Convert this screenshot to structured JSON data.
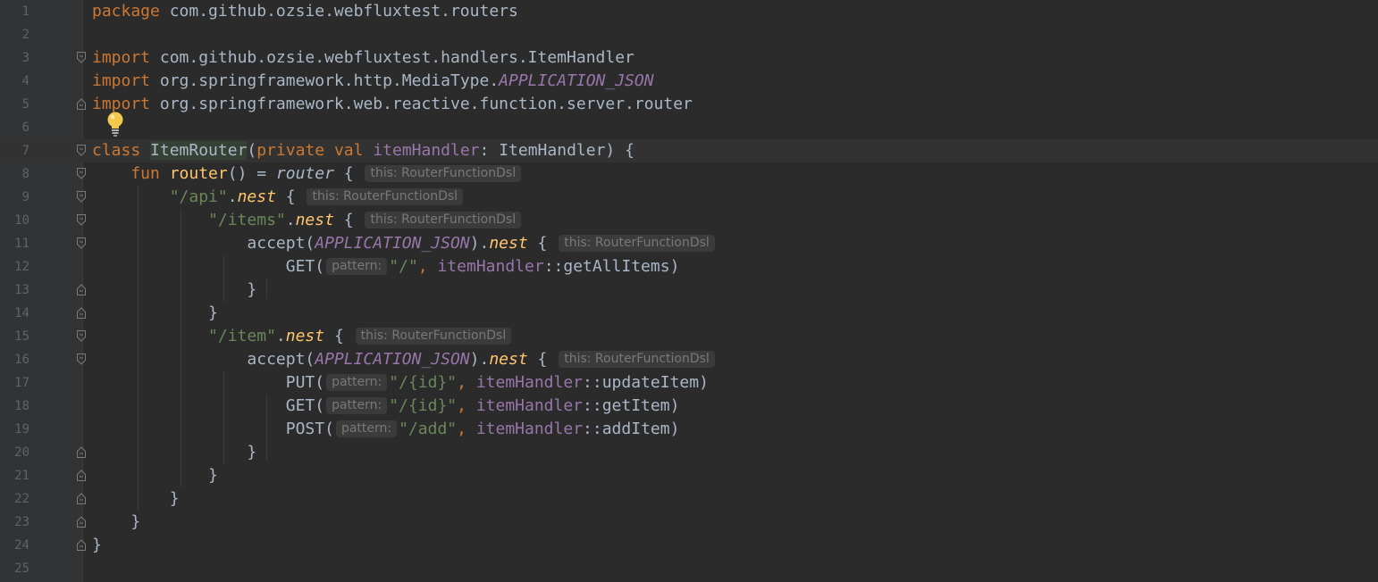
{
  "editor": {
    "language": "kotlin",
    "current_line": 7,
    "lines": [
      {
        "n": "1",
        "fold": "",
        "tokens": [
          {
            "t": "package",
            "c": "kw"
          },
          {
            "t": " com.github.ozsie.webfluxtest.routers",
            "c": ""
          }
        ]
      },
      {
        "n": "2",
        "fold": "",
        "tokens": []
      },
      {
        "n": "3",
        "fold": "open",
        "tokens": [
          {
            "t": "import",
            "c": "kw"
          },
          {
            "t": " com.github.ozsie.webfluxtest.handlers.ItemHandler",
            "c": ""
          }
        ]
      },
      {
        "n": "4",
        "fold": "",
        "tokens": [
          {
            "t": "import",
            "c": "kw"
          },
          {
            "t": " org.springframework.http.MediaType.",
            "c": ""
          },
          {
            "t": "APPLICATION_JSON",
            "c": "const"
          }
        ]
      },
      {
        "n": "5",
        "fold": "close",
        "tokens": [
          {
            "t": "import",
            "c": "kw"
          },
          {
            "t": " org.springframework.web.reactive.function.server.router",
            "c": ""
          }
        ]
      },
      {
        "n": "6",
        "fold": "",
        "tokens": []
      },
      {
        "n": "7",
        "fold": "open",
        "tokens": [
          {
            "t": "class",
            "c": "kw"
          },
          {
            "t": " ",
            "c": ""
          },
          {
            "t": "ItemRouter",
            "c": "cls-hl"
          },
          {
            "t": "(",
            "c": ""
          },
          {
            "t": "private val",
            "c": "kw"
          },
          {
            "t": " ",
            "c": ""
          },
          {
            "t": "itemHandler",
            "c": "prop"
          },
          {
            "t": ": ItemHandler) {",
            "c": ""
          }
        ]
      },
      {
        "n": "8",
        "fold": "open",
        "tokens": [
          {
            "t": "    fun",
            "c": "kw"
          },
          {
            "t": " ",
            "c": ""
          },
          {
            "t": "router",
            "c": "fn"
          },
          {
            "t": "() = ",
            "c": ""
          },
          {
            "t": "router",
            "c": "ital"
          },
          {
            "t": " { ",
            "c": ""
          },
          {
            "t": "this: RouterFunctionDsl",
            "c": "hint"
          }
        ]
      },
      {
        "n": "9",
        "fold": "open",
        "tokens": [
          {
            "t": "        ",
            "c": ""
          },
          {
            "t": "\"/api\"",
            "c": "str"
          },
          {
            "t": ".",
            "c": ""
          },
          {
            "t": "nest",
            "c": "ext"
          },
          {
            "t": " { ",
            "c": ""
          },
          {
            "t": "this: RouterFunctionDsl",
            "c": "hint"
          }
        ]
      },
      {
        "n": "10",
        "fold": "open",
        "tokens": [
          {
            "t": "            ",
            "c": ""
          },
          {
            "t": "\"/items\"",
            "c": "str"
          },
          {
            "t": ".",
            "c": ""
          },
          {
            "t": "nest",
            "c": "ext"
          },
          {
            "t": " { ",
            "c": ""
          },
          {
            "t": "this: RouterFunctionDsl",
            "c": "hint"
          }
        ]
      },
      {
        "n": "11",
        "fold": "open",
        "tokens": [
          {
            "t": "                accept(",
            "c": ""
          },
          {
            "t": "APPLICATION_JSON",
            "c": "const"
          },
          {
            "t": ").",
            "c": ""
          },
          {
            "t": "nest",
            "c": "ext"
          },
          {
            "t": " { ",
            "c": ""
          },
          {
            "t": "this: RouterFunctionDsl",
            "c": "hint"
          }
        ]
      },
      {
        "n": "12",
        "fold": "",
        "tokens": [
          {
            "t": "                    GET(",
            "c": ""
          },
          {
            "t": "pattern:",
            "c": "hint"
          },
          {
            "t": "\"/\"",
            "c": "str"
          },
          {
            "t": ", ",
            "c": "kw"
          },
          {
            "t": "itemHandler",
            "c": "prop"
          },
          {
            "t": "::getAllItems)",
            "c": ""
          }
        ]
      },
      {
        "n": "13",
        "fold": "close",
        "tokens": [
          {
            "t": "                }",
            "c": ""
          }
        ]
      },
      {
        "n": "14",
        "fold": "close",
        "tokens": [
          {
            "t": "            }",
            "c": ""
          }
        ]
      },
      {
        "n": "15",
        "fold": "open",
        "tokens": [
          {
            "t": "            ",
            "c": ""
          },
          {
            "t": "\"/item\"",
            "c": "str"
          },
          {
            "t": ".",
            "c": ""
          },
          {
            "t": "nest",
            "c": "ext"
          },
          {
            "t": " { ",
            "c": ""
          },
          {
            "t": "this: RouterFunctionDsl",
            "c": "hint"
          }
        ]
      },
      {
        "n": "16",
        "fold": "open",
        "tokens": [
          {
            "t": "                accept(",
            "c": ""
          },
          {
            "t": "APPLICATION_JSON",
            "c": "const"
          },
          {
            "t": ").",
            "c": ""
          },
          {
            "t": "nest",
            "c": "ext"
          },
          {
            "t": " { ",
            "c": ""
          },
          {
            "t": "this: RouterFunctionDsl",
            "c": "hint"
          }
        ]
      },
      {
        "n": "17",
        "fold": "",
        "tokens": [
          {
            "t": "                    PUT(",
            "c": ""
          },
          {
            "t": "pattern:",
            "c": "hint"
          },
          {
            "t": "\"/{id}\"",
            "c": "str"
          },
          {
            "t": ", ",
            "c": "kw"
          },
          {
            "t": "itemHandler",
            "c": "prop"
          },
          {
            "t": "::updateItem)",
            "c": ""
          }
        ]
      },
      {
        "n": "18",
        "fold": "",
        "tokens": [
          {
            "t": "                    GET(",
            "c": ""
          },
          {
            "t": "pattern:",
            "c": "hint"
          },
          {
            "t": "\"/{id}\"",
            "c": "str"
          },
          {
            "t": ", ",
            "c": "kw"
          },
          {
            "t": "itemHandler",
            "c": "prop"
          },
          {
            "t": "::getItem)",
            "c": ""
          }
        ]
      },
      {
        "n": "19",
        "fold": "",
        "tokens": [
          {
            "t": "                    POST(",
            "c": ""
          },
          {
            "t": "pattern:",
            "c": "hint"
          },
          {
            "t": "\"/add\"",
            "c": "str"
          },
          {
            "t": ", ",
            "c": "kw"
          },
          {
            "t": "itemHandler",
            "c": "prop"
          },
          {
            "t": "::addItem)",
            "c": ""
          }
        ]
      },
      {
        "n": "20",
        "fold": "close",
        "tokens": [
          {
            "t": "                }",
            "c": ""
          }
        ]
      },
      {
        "n": "21",
        "fold": "close",
        "tokens": [
          {
            "t": "            }",
            "c": ""
          }
        ]
      },
      {
        "n": "22",
        "fold": "close",
        "tokens": [
          {
            "t": "        }",
            "c": ""
          }
        ]
      },
      {
        "n": "23",
        "fold": "close",
        "tokens": [
          {
            "t": "    }",
            "c": ""
          }
        ]
      },
      {
        "n": "24",
        "fold": "close",
        "tokens": [
          {
            "t": "}",
            "c": ""
          }
        ]
      },
      {
        "n": "25",
        "fold": "",
        "tokens": []
      }
    ]
  },
  "icons": {
    "intention_bulb": "lightbulb-icon",
    "fold_open": "fold-open-icon",
    "fold_close": "fold-close-icon"
  },
  "colors": {
    "background": "#2b2b2b",
    "gutter": "#313335",
    "keyword": "#cc7832",
    "string": "#6a8759",
    "function": "#ffc66d",
    "property": "#9876aa",
    "default_text": "#a9b7c6",
    "line_number": "#606366"
  }
}
